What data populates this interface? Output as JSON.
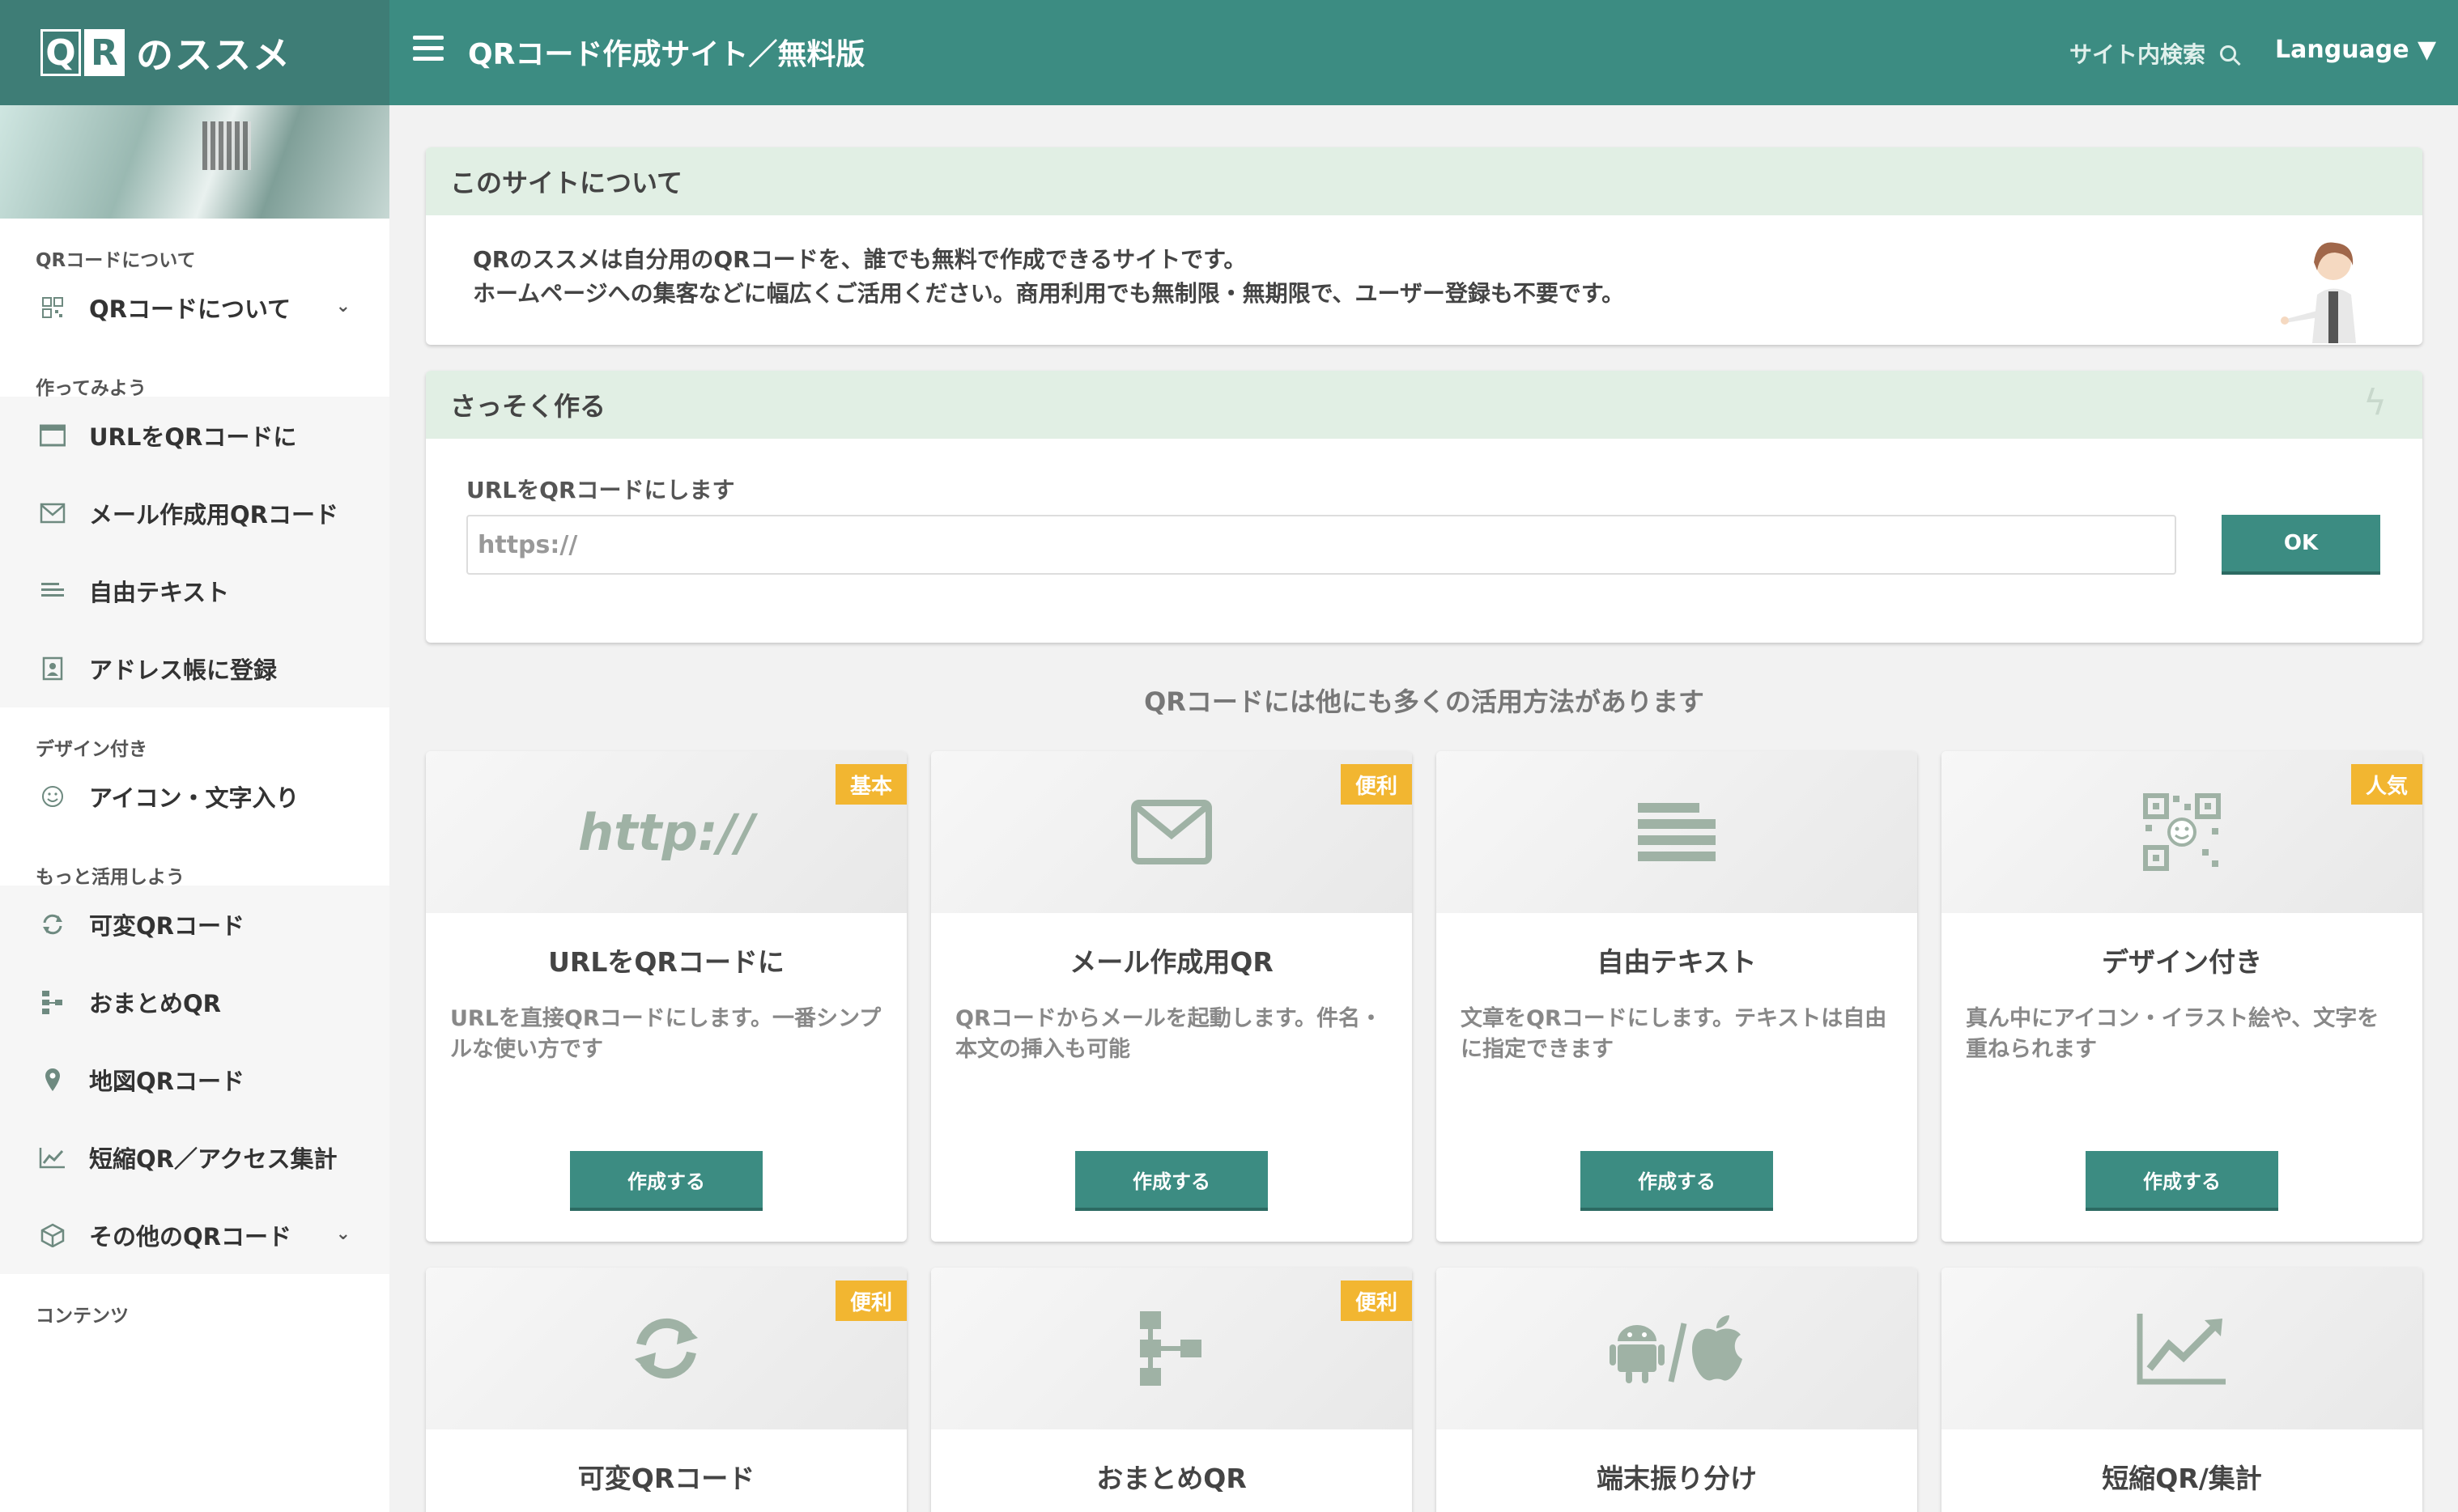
{
  "header": {
    "logo_q": "Q",
    "logo_r": "R",
    "logo_text": "のススメ",
    "title": "QRコード作成サイト／無料版",
    "search_label": "サイト内検索",
    "language_label": "Language ▼"
  },
  "sidebar": {
    "sections": [
      {
        "title": "QRコードについて",
        "items": [
          {
            "label": "QRコードについて",
            "icon": "qr-icon",
            "has_dropdown": true
          }
        ]
      },
      {
        "title": "作ってみよう",
        "items": [
          {
            "label": "URLをQRコードに",
            "icon": "browser-window-icon"
          },
          {
            "label": "メール作成用QRコード",
            "icon": "envelope-icon"
          },
          {
            "label": "自由テキスト",
            "icon": "text-lines-icon"
          },
          {
            "label": "アドレス帳に登録",
            "icon": "contact-card-icon"
          }
        ]
      },
      {
        "title": "デザイン付き",
        "items": [
          {
            "label": "アイコン・文字入り",
            "icon": "smiley-icon"
          }
        ]
      },
      {
        "title": "もっと活用しよう",
        "items": [
          {
            "label": "可変QRコード",
            "icon": "refresh-icon"
          },
          {
            "label": "おまとめQR",
            "icon": "sitemap-icon"
          },
          {
            "label": "地図QRコード",
            "icon": "map-pin-icon"
          },
          {
            "label": "短縮QR／アクセス集計",
            "icon": "line-chart-icon"
          },
          {
            "label": "その他のQRコード",
            "icon": "cube-icon",
            "has_dropdown": true
          }
        ]
      },
      {
        "title": "コンテンツ",
        "items": []
      }
    ]
  },
  "about": {
    "heading": "このサイトについて",
    "line1": "QRのススメは自分用のQRコードを、誰でも無料で作成できるサイトです。",
    "line2": "ホームページへの集客などに幅広くご活用ください。商用利用でも無制限・無期限で、ユーザー登録も不要です。"
  },
  "quick": {
    "heading": "さっそく作る",
    "label": "URLをQRコードにします",
    "input_value": "https://",
    "ok_label": "OK"
  },
  "more_title": "QRコードには他にも多くの活用方法があります",
  "cards": [
    {
      "badge": "基本",
      "icon": "http-icon",
      "icon_text": "http://",
      "title": "URLをQRコードに",
      "desc": "URLを直接QRコードにします。一番シンプルな使い方です",
      "button": "作成する"
    },
    {
      "badge": "便利",
      "icon": "envelope-icon",
      "title": "メール作成用QR",
      "desc": "QRコードからメールを起動します。件名・本文の挿入も可能",
      "button": "作成する"
    },
    {
      "badge": "",
      "icon": "text-lines-icon",
      "title": "自由テキスト",
      "desc": "文章をQRコードにします。テキストは自由に指定できます",
      "button": "作成する"
    },
    {
      "badge": "人気",
      "icon": "qr-smiley-icon",
      "title": "デザイン付き",
      "desc": "真ん中にアイコン・イラスト絵や、文字を重ねられます",
      "button": "作成する"
    },
    {
      "badge": "便利",
      "icon": "refresh-icon",
      "title": "可変QRコード"
    },
    {
      "badge": "便利",
      "icon": "sitemap-icon",
      "title": "おまとめQR"
    },
    {
      "badge": "",
      "icon": "android-apple-icon",
      "title": "端末振り分け"
    },
    {
      "badge": "",
      "icon": "line-chart-icon",
      "title": "短縮QR/集計"
    }
  ],
  "colors": {
    "primary": "#3c8c82",
    "badge": "#f2b631",
    "panel_header": "#e1efe4"
  }
}
